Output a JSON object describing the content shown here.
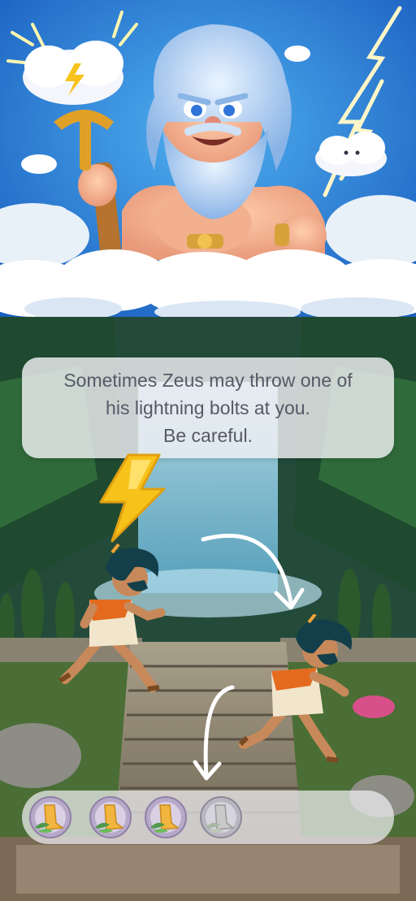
{
  "message": {
    "line1": "Sometimes Zeus may throw one of",
    "line2": "his lightning bolts at you.",
    "line3": "Be careful."
  },
  "lives": {
    "total": 4,
    "remaining": 3,
    "icons": [
      "winged-sandal-icon",
      "winged-sandal-icon",
      "winged-sandal-icon",
      "winged-sandal-lost-icon"
    ]
  },
  "colors": {
    "bolt": "#f7c21a",
    "panel": "#f0f0f4",
    "text": "#555a66",
    "sandal_active": "#f2b640",
    "sandal_lost": "#c9c9c9"
  }
}
